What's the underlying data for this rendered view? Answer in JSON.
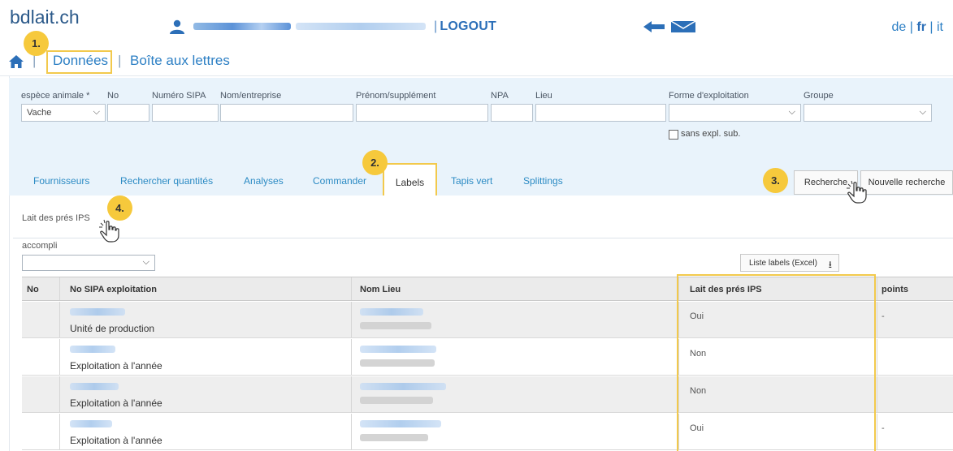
{
  "header": {
    "logo": "bdlait.ch",
    "logout": "LOGOUT",
    "langs": [
      "de",
      "fr",
      "it"
    ],
    "active_lang": "fr"
  },
  "nav": {
    "links": [
      "Données",
      "Boîte aux lettres"
    ]
  },
  "filters": {
    "labels": {
      "espece": "espèce animale *",
      "no": "No",
      "sipa": "Numéro SIPA",
      "entreprise": "Nom/entreprise",
      "prenom": "Prénom/supplément",
      "npa": "NPA",
      "lieu": "Lieu",
      "forme": "Forme d'exploitation",
      "groupe": "Groupe"
    },
    "espece_value": "Vache",
    "sans_expl": "sans expl. sub."
  },
  "tabs": [
    "Fournisseurs",
    "Rechercher quantités",
    "Analyses",
    "Commander",
    "Labels",
    "Tapis vert",
    "Splittings"
  ],
  "active_tab": "Labels",
  "buttons": {
    "recherche": "Recherche",
    "nouvelle": "Nouvelle recherche"
  },
  "panel": {
    "subtab": "Lait des prés IPS",
    "accompli_label": "accompli",
    "excel_button": "Liste labels (Excel)"
  },
  "table": {
    "headers": [
      "No",
      "No SIPA exploitation",
      "Nom Lieu",
      "Lait des prés IPS",
      "points"
    ],
    "rows": [
      {
        "type": "Unité de production",
        "ips": "Oui",
        "points": "-"
      },
      {
        "type": "Exploitation à l'année",
        "ips": "Non",
        "points": ""
      },
      {
        "type": "Exploitation à l'année",
        "ips": "Non",
        "points": ""
      },
      {
        "type": "Exploitation à l'année",
        "ips": "Oui",
        "points": "-"
      }
    ]
  },
  "steps": [
    "1.",
    "2.",
    "3.",
    "4."
  ],
  "colors": {
    "accent": "#2c7fc4",
    "highlight": "#f2c94c",
    "step_marker": "#f6c93c",
    "filter_bg": "#e9f3fb"
  }
}
